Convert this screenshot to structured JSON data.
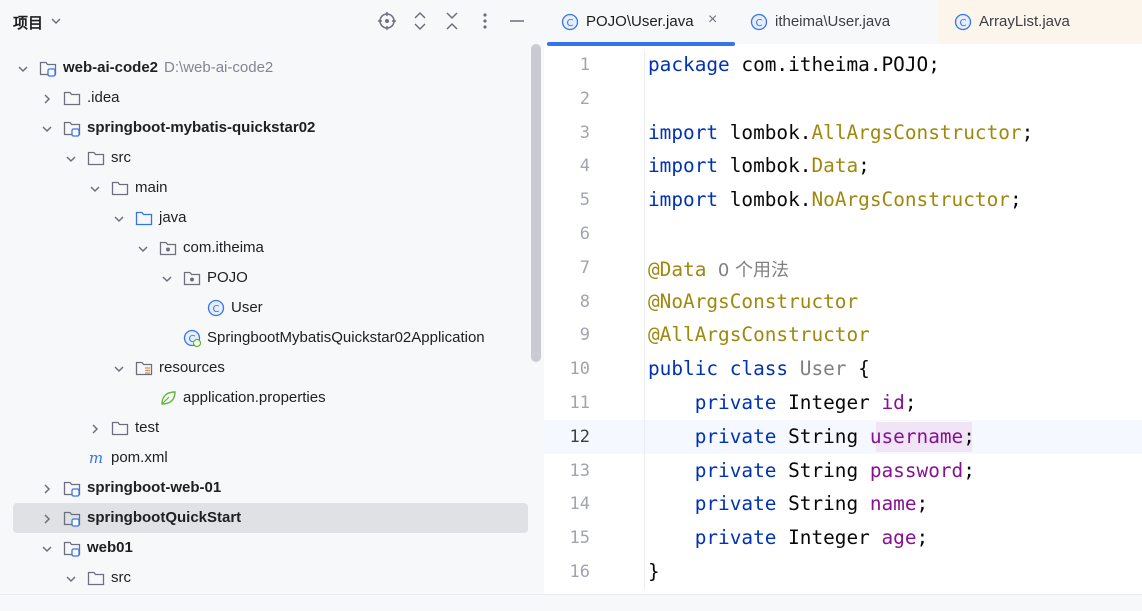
{
  "project_panel": {
    "title": "项目",
    "tree": [
      {
        "label": "web-ai-code2",
        "path": "D:\\web-ai-code2",
        "bold": true,
        "icon": "module-folder-icon",
        "arrow": "expanded",
        "depth": 0
      },
      {
        "label": ".idea",
        "bold": false,
        "icon": "folder-icon",
        "arrow": "collapsed",
        "depth": 1
      },
      {
        "label": "springboot-mybatis-quickstar02",
        "bold": true,
        "icon": "module-folder-icon",
        "arrow": "expanded",
        "depth": 1
      },
      {
        "label": "src",
        "bold": false,
        "icon": "folder-icon",
        "arrow": "expanded",
        "depth": 2
      },
      {
        "label": "main",
        "bold": false,
        "icon": "folder-icon",
        "arrow": "expanded",
        "depth": 3
      },
      {
        "label": "java",
        "bold": false,
        "icon": "source-folder-icon",
        "arrow": "expanded",
        "depth": 4
      },
      {
        "label": "com.itheima",
        "bold": false,
        "icon": "package-icon",
        "arrow": "expanded",
        "depth": 5
      },
      {
        "label": "POJO",
        "bold": false,
        "icon": "package-icon",
        "arrow": "expanded",
        "depth": 6
      },
      {
        "label": "User",
        "bold": false,
        "icon": "class-icon",
        "arrow": "none",
        "depth": 7
      },
      {
        "label": "SpringbootMybatisQuickstar02Application",
        "bold": false,
        "icon": "spring-boot-class-icon",
        "arrow": "none",
        "depth": 6
      },
      {
        "label": "resources",
        "bold": false,
        "icon": "resources-folder-icon",
        "arrow": "expanded",
        "depth": 4
      },
      {
        "label": "application.properties",
        "bold": false,
        "icon": "spring-properties-icon",
        "arrow": "none",
        "depth": 5
      },
      {
        "label": "test",
        "bold": false,
        "icon": "folder-icon",
        "arrow": "collapsed",
        "depth": 3
      },
      {
        "label": "pom.xml",
        "bold": false,
        "icon": "maven-icon",
        "arrow": "none",
        "depth": 2
      },
      {
        "label": "springboot-web-01",
        "bold": true,
        "icon": "module-folder-icon",
        "arrow": "collapsed",
        "depth": 1
      },
      {
        "label": "springbootQuickStart",
        "bold": true,
        "icon": "module-folder-icon",
        "arrow": "collapsed",
        "depth": 1,
        "selected": true
      },
      {
        "label": "web01",
        "bold": true,
        "icon": "module-folder-icon",
        "arrow": "expanded",
        "depth": 1
      },
      {
        "label": "src",
        "bold": false,
        "icon": "folder-icon",
        "arrow": "expanded",
        "depth": 2
      }
    ]
  },
  "editor": {
    "tabs": [
      {
        "label": "POJO\\User.java",
        "active": true,
        "close": "×"
      },
      {
        "label": "itheima\\User.java",
        "active": false
      },
      {
        "label": "ArrayList.java",
        "active": false
      }
    ],
    "current_line": 12,
    "code_lines": [
      [
        {
          "t": "package ",
          "c": "kw"
        },
        {
          "t": "com.itheima.POJO;",
          "c": ""
        }
      ],
      [],
      [
        {
          "t": "import ",
          "c": "kw"
        },
        {
          "t": "lombok.",
          "c": ""
        },
        {
          "t": "AllArgsConstructor",
          "c": "an"
        },
        {
          "t": ";",
          "c": ""
        }
      ],
      [
        {
          "t": "import ",
          "c": "kw"
        },
        {
          "t": "lombok.",
          "c": ""
        },
        {
          "t": "Data",
          "c": "an"
        },
        {
          "t": ";",
          "c": ""
        }
      ],
      [
        {
          "t": "import ",
          "c": "kw"
        },
        {
          "t": "lombok.",
          "c": ""
        },
        {
          "t": "NoArgsConstructor",
          "c": "an"
        },
        {
          "t": ";",
          "c": ""
        }
      ],
      [],
      [
        {
          "t": "@Data",
          "c": "an"
        },
        {
          "t": "  0 个用法",
          "c": "hint"
        }
      ],
      [
        {
          "t": "@NoArgsConstructor",
          "c": "an"
        }
      ],
      [
        {
          "t": "@AllArgsConstructor",
          "c": "an"
        }
      ],
      [
        {
          "t": "public ",
          "c": "kw"
        },
        {
          "t": "class ",
          "c": "kw"
        },
        {
          "t": "User",
          "c": "cn"
        },
        {
          "t": " {",
          "c": ""
        }
      ],
      [
        {
          "t": "    private ",
          "c": "kw"
        },
        {
          "t": "Integer ",
          "c": ""
        },
        {
          "t": "id",
          "c": "fd"
        },
        {
          "t": ";",
          "c": ""
        }
      ],
      [
        {
          "t": "    private ",
          "c": "kw"
        },
        {
          "t": "String ",
          "c": ""
        },
        {
          "t": "username",
          "c": "fd"
        },
        {
          "t": ";",
          "c": ""
        }
      ],
      [
        {
          "t": "    private ",
          "c": "kw"
        },
        {
          "t": "String ",
          "c": ""
        },
        {
          "t": "password",
          "c": "fd"
        },
        {
          "t": ";",
          "c": ""
        }
      ],
      [
        {
          "t": "    private ",
          "c": "kw"
        },
        {
          "t": "String ",
          "c": ""
        },
        {
          "t": "name",
          "c": "fd"
        },
        {
          "t": ";",
          "c": ""
        }
      ],
      [
        {
          "t": "    private ",
          "c": "kw"
        },
        {
          "t": "Integer ",
          "c": ""
        },
        {
          "t": "age",
          "c": "fd"
        },
        {
          "t": ";",
          "c": ""
        }
      ],
      [
        {
          "t": "}",
          "c": ""
        }
      ]
    ],
    "line_numbers": [
      "1",
      "2",
      "3",
      "4",
      "5",
      "6",
      "7",
      "8",
      "9",
      "10",
      "11",
      "12",
      "13",
      "14",
      "15",
      "16"
    ]
  },
  "colors": {
    "accent": "#3574f0",
    "keyword": "#0033b3",
    "annotation": "#9e880d",
    "field": "#871094",
    "selection_bg": "#dfe1e5"
  },
  "icons": {
    "header_buttons": [
      "locate-icon",
      "expand-all-icon",
      "collapse-all-icon",
      "more-options-icon",
      "minimize-icon"
    ]
  }
}
